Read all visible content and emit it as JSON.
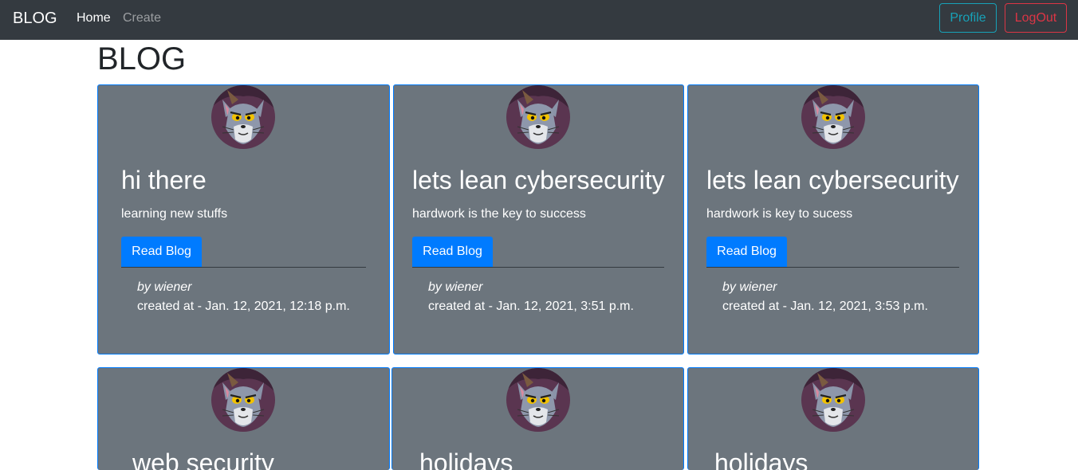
{
  "navbar": {
    "brand": "BLOG",
    "links": {
      "home": "Home",
      "create": "Create"
    },
    "buttons": {
      "profile": "Profile",
      "logout": "LogOut"
    },
    "colors": {
      "background": "#343a40",
      "profile": "#17a2b8",
      "logout": "#dc3545"
    }
  },
  "page": {
    "title": "BLOG"
  },
  "cards": [
    {
      "avatar_icon": "cartoon-cat-avatar-icon",
      "title": "hi there",
      "text": "learning new stuffs",
      "button": "Read Blog",
      "author": "by wiener",
      "created": "created at - Jan. 12, 2021, 12:18 p.m."
    },
    {
      "avatar_icon": "cartoon-cat-avatar-icon",
      "title": "lets lean cybersecurity",
      "text": "hardwork is the key to success",
      "button": "Read Blog",
      "author": "by wiener",
      "created": "created at - Jan. 12, 2021, 3:51 p.m."
    },
    {
      "avatar_icon": "cartoon-cat-avatar-icon",
      "title": "lets lean cybersecurity",
      "text": "hardwork is key to sucess",
      "button": "Read Blog",
      "author": "by wiener",
      "created": "created at - Jan. 12, 2021, 3:53 p.m."
    },
    {
      "avatar_icon": "cartoon-cat-avatar-icon",
      "title": "web security"
    },
    {
      "avatar_icon": "cartoon-cat-avatar-icon",
      "title": "holidays"
    },
    {
      "avatar_icon": "cartoon-cat-avatar-icon",
      "title": "holidays"
    }
  ],
  "colors": {
    "card_background": "#6c757d",
    "card_border": "#007bff",
    "button": "#007bff"
  }
}
